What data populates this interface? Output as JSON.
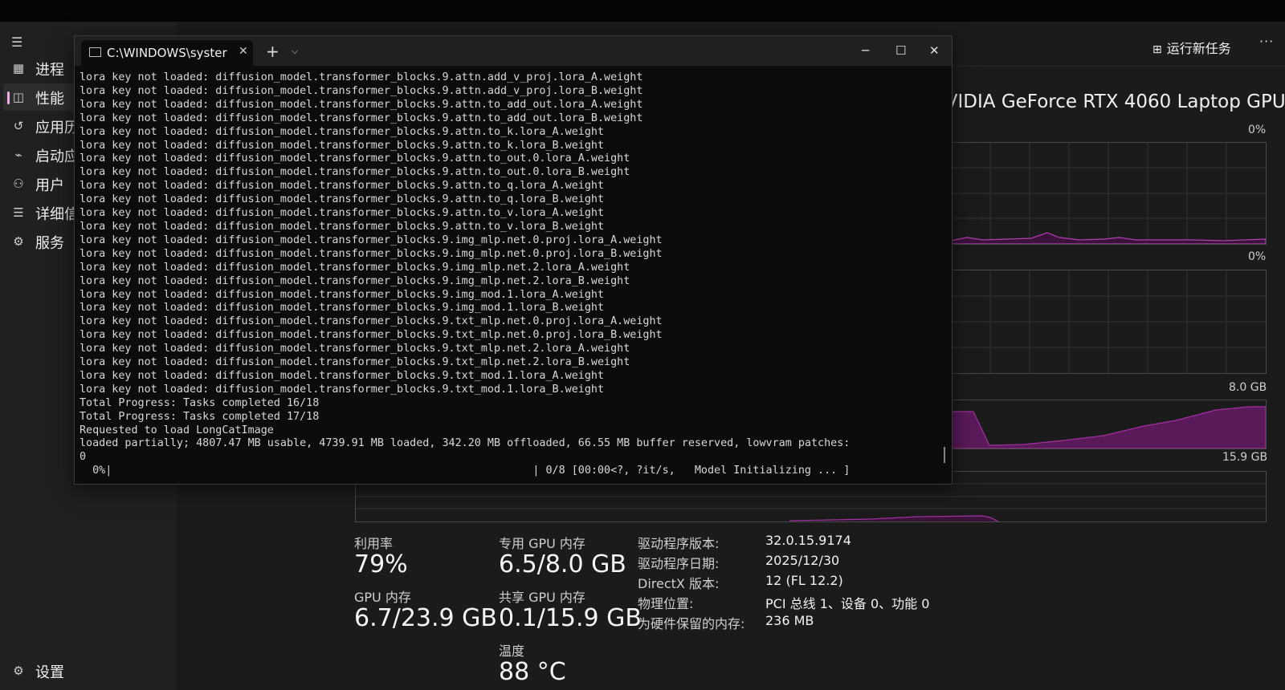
{
  "sidebar": {
    "items": [
      {
        "label": "进程",
        "icon": "processes-icon"
      },
      {
        "label": "性能",
        "icon": "performance-icon"
      },
      {
        "label": "应用历",
        "icon": "app-history-icon"
      },
      {
        "label": "启动应",
        "icon": "startup-apps-icon"
      },
      {
        "label": "用户",
        "icon": "users-icon"
      },
      {
        "label": "详细信",
        "icon": "details-icon"
      },
      {
        "label": "服务",
        "icon": "services-icon"
      }
    ],
    "settings_label": "设置"
  },
  "header": {
    "run_task_label": "运行新任务",
    "more_label": "···"
  },
  "gpu": {
    "name": "IVIDIA GeForce RTX 4060 Laptop GPU",
    "graph1_max": "0%",
    "graph2_max": "0%",
    "graph3_max": "8.0 GB",
    "graph4_max": "15.9 GB",
    "utilization_label": "利用率",
    "utilization_value": "79%",
    "dedicated_label": "专用 GPU 内存",
    "dedicated_value": "6.5/8.0 GB",
    "gpu_mem_label": "GPU 内存",
    "gpu_mem_value": "6.7/23.9 GB",
    "shared_label": "共享 GPU 内存",
    "shared_value": "0.1/15.9 GB",
    "temp_label": "温度",
    "temp_value": "88 °C",
    "props": [
      {
        "k": "驱动程序版本:",
        "v": "32.0.15.9174"
      },
      {
        "k": "驱动程序日期:",
        "v": "2025/12/30"
      },
      {
        "k": "DirectX 版本:",
        "v": "12 (FL 12.2)"
      },
      {
        "k": "物理位置:",
        "v": "PCI 总线 1、设备 0、功能 0"
      },
      {
        "k": "为硬件保留的内存:",
        "v": "236 MB"
      }
    ]
  },
  "terminal": {
    "tab_title": "C:\\WINDOWS\\syster",
    "lines": [
      "lora key not loaded: diffusion_model.transformer_blocks.9.attn.add_v_proj.lora_A.weight",
      "lora key not loaded: diffusion_model.transformer_blocks.9.attn.add_v_proj.lora_B.weight",
      "lora key not loaded: diffusion_model.transformer_blocks.9.attn.to_add_out.lora_A.weight",
      "lora key not loaded: diffusion_model.transformer_blocks.9.attn.to_add_out.lora_B.weight",
      "lora key not loaded: diffusion_model.transformer_blocks.9.attn.to_k.lora_A.weight",
      "lora key not loaded: diffusion_model.transformer_blocks.9.attn.to_k.lora_B.weight",
      "lora key not loaded: diffusion_model.transformer_blocks.9.attn.to_out.0.lora_A.weight",
      "lora key not loaded: diffusion_model.transformer_blocks.9.attn.to_out.0.lora_B.weight",
      "lora key not loaded: diffusion_model.transformer_blocks.9.attn.to_q.lora_A.weight",
      "lora key not loaded: diffusion_model.transformer_blocks.9.attn.to_q.lora_B.weight",
      "lora key not loaded: diffusion_model.transformer_blocks.9.attn.to_v.lora_A.weight",
      "lora key not loaded: diffusion_model.transformer_blocks.9.attn.to_v.lora_B.weight",
      "lora key not loaded: diffusion_model.transformer_blocks.9.img_mlp.net.0.proj.lora_A.weight",
      "lora key not loaded: diffusion_model.transformer_blocks.9.img_mlp.net.0.proj.lora_B.weight",
      "lora key not loaded: diffusion_model.transformer_blocks.9.img_mlp.net.2.lora_A.weight",
      "lora key not loaded: diffusion_model.transformer_blocks.9.img_mlp.net.2.lora_B.weight",
      "lora key not loaded: diffusion_model.transformer_blocks.9.img_mod.1.lora_A.weight",
      "lora key not loaded: diffusion_model.transformer_blocks.9.img_mod.1.lora_B.weight",
      "lora key not loaded: diffusion_model.transformer_blocks.9.txt_mlp.net.0.proj.lora_A.weight",
      "lora key not loaded: diffusion_model.transformer_blocks.9.txt_mlp.net.0.proj.lora_B.weight",
      "lora key not loaded: diffusion_model.transformer_blocks.9.txt_mlp.net.2.lora_A.weight",
      "lora key not loaded: diffusion_model.transformer_blocks.9.txt_mlp.net.2.lora_B.weight",
      "lora key not loaded: diffusion_model.transformer_blocks.9.txt_mod.1.lora_A.weight",
      "lora key not loaded: diffusion_model.transformer_blocks.9.txt_mod.1.lora_B.weight",
      "Total Progress: Tasks completed 16/18",
      "Total Progress: Tasks completed 17/18",
      "Requested to load LongCatImage",
      "loaded partially; 4807.47 MB usable, 4739.91 MB loaded, 342.20 MB offloaded, 66.55 MB buffer reserved, lowvram patches:",
      "0",
      "  0%|                                                                 | 0/8 [00:00<?, ?it/s,   Model Initializing ... ]"
    ]
  },
  "colors": {
    "accent": "#f0a8e8",
    "graph_line": "#8a2a8a",
    "graph_fill": "#5a1a5a"
  }
}
